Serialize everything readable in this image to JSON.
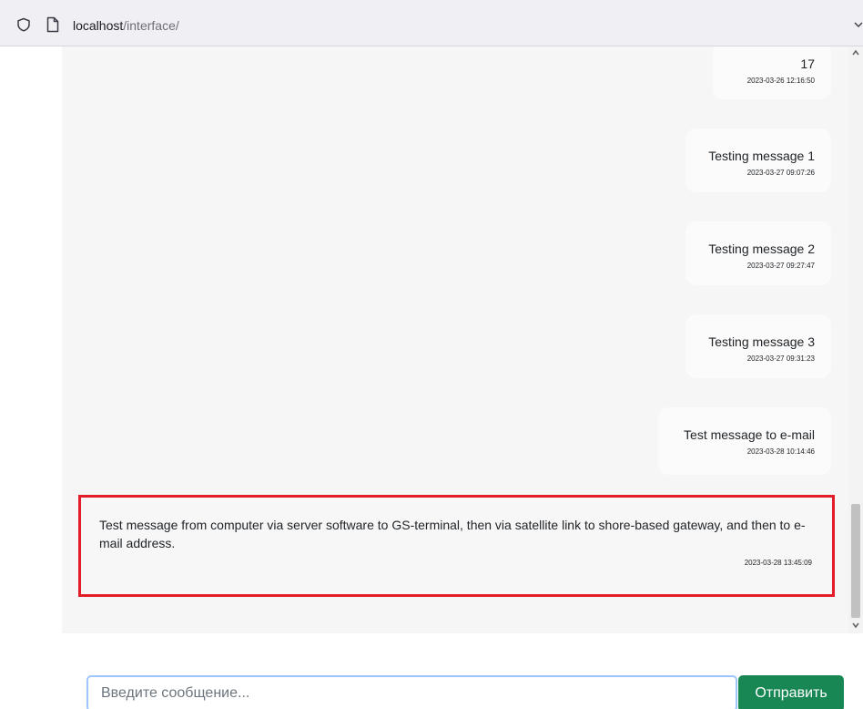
{
  "browser": {
    "url_host": "localhost",
    "url_path": "/interface/"
  },
  "messages": [
    {
      "text": "17",
      "time": "2023-03-26 12:16:50"
    },
    {
      "text": "Testing message 1",
      "time": "2023-03-27 09:07:26"
    },
    {
      "text": "Testing message 2",
      "time": "2023-03-27 09:27:47"
    },
    {
      "text": "Testing message 3",
      "time": "2023-03-27 09:31:23"
    },
    {
      "text": "Test message to e-mail",
      "time": "2023-03-28 10:14:46"
    },
    {
      "text": "Test message from computer via server software to GS-terminal, then via satellite link to shore-based gateway, and then to e-mail address.",
      "time": "2023-03-28 13:45:09"
    }
  ],
  "composer": {
    "placeholder": "Введите сообщение...",
    "send_label": "Отправить"
  },
  "colors": {
    "highlight_border": "#e31c2a",
    "send_button": "#198754",
    "input_focus_border": "#9ec5fe"
  }
}
